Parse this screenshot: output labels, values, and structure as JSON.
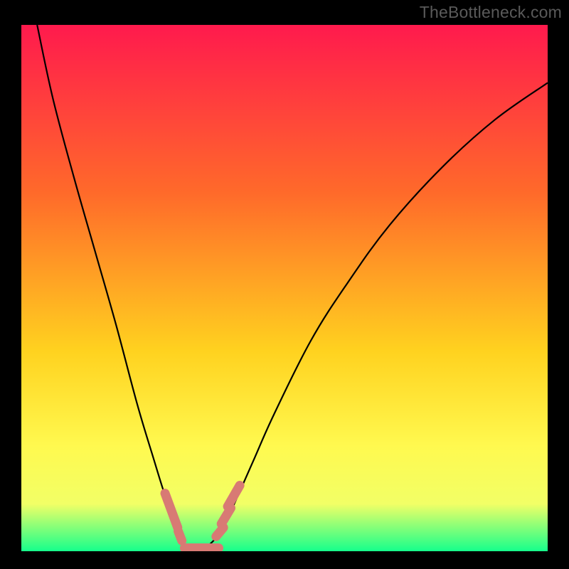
{
  "watermark": "TheBottleneck.com",
  "colors": {
    "background": "#000000",
    "gradient_top": "#ff1a4d",
    "gradient_mid1": "#ff6a2a",
    "gradient_mid2": "#ffd21f",
    "gradient_mid3": "#fff94f",
    "gradient_mid4": "#f2ff66",
    "gradient_bottom": "#16ff8c",
    "curve": "#000000",
    "highlight": "#d87a74"
  },
  "chart_data": {
    "type": "line",
    "title": "",
    "xlabel": "",
    "ylabel": "",
    "xlim": [
      0,
      100
    ],
    "ylim": [
      0,
      100
    ],
    "grid": false,
    "series": [
      {
        "name": "bottleneck-curve",
        "x": [
          3,
          6,
          10,
          14,
          18,
          22,
          25,
          27.5,
          29.5,
          31,
          32.5,
          34,
          36,
          38,
          40,
          44,
          48,
          55,
          62,
          70,
          80,
          90,
          100
        ],
        "y": [
          100,
          86,
          71,
          57,
          43,
          28,
          18,
          10,
          5,
          1.5,
          0.5,
          0.5,
          1.5,
          4,
          8,
          17,
          26,
          40,
          51,
          62,
          73,
          82,
          89
        ]
      }
    ],
    "annotations": [
      {
        "name": "highlight-segments",
        "segments": [
          {
            "x": [
              27.3,
              29.7
            ],
            "y": [
              11.0,
              4.5
            ]
          },
          {
            "x": [
              29.8,
              30.5
            ],
            "y": [
              3.8,
              2.0
            ]
          },
          {
            "x": [
              31.0,
              37.5
            ],
            "y": [
              0.6,
              0.6
            ]
          },
          {
            "x": [
              37.0,
              38.4
            ],
            "y": [
              2.8,
              4.5
            ]
          },
          {
            "x": [
              38.0,
              39.8
            ],
            "y": [
              5.2,
              8.2
            ]
          },
          {
            "x": [
              39.2,
              41.5
            ],
            "y": [
              8.5,
              12.5
            ]
          }
        ],
        "color_key": "highlight"
      }
    ]
  }
}
